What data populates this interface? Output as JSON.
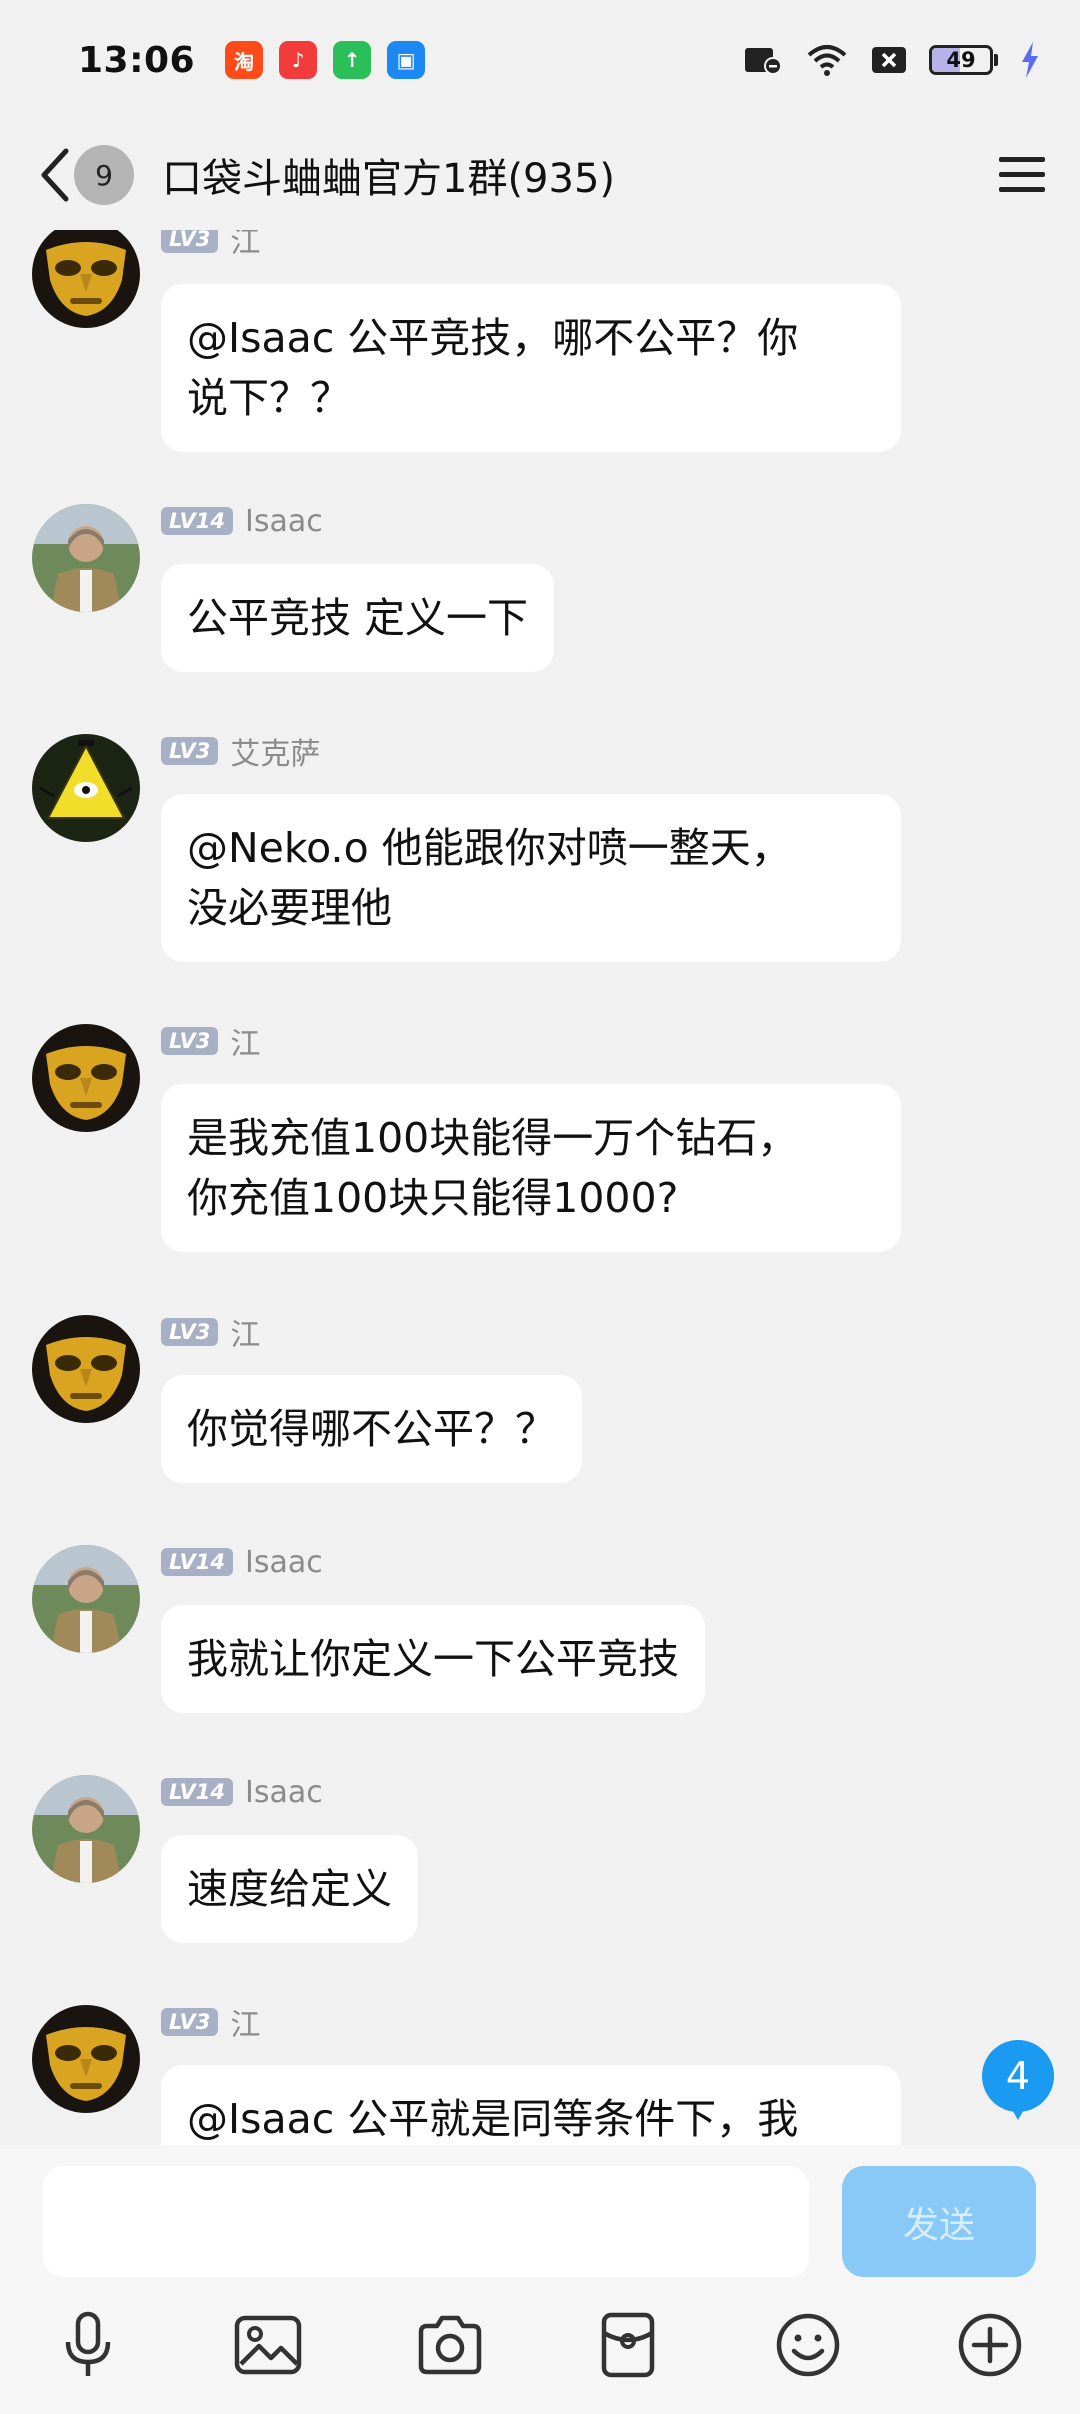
{
  "status_bar": {
    "time": "13:06",
    "apps": [
      {
        "icon": "taobao-icon",
        "glyph": "淘",
        "color": "#ff4a1a"
      },
      {
        "icon": "music-icon",
        "glyph": "♪",
        "color": "#f23b3b"
      },
      {
        "icon": "upload-icon",
        "glyph": "↑",
        "color": "#2bbf5a"
      },
      {
        "icon": "wallet-icon",
        "glyph": "▣",
        "color": "#1e88f2"
      }
    ],
    "battery_level": "49"
  },
  "header": {
    "unread_count": "9",
    "title": "口袋斗蛐蛐官方1群(935)"
  },
  "messages": [
    {
      "sender": "江",
      "level": "LV3",
      "avatar": "mask",
      "text_lines": [
        "@Isaac 公平竞技，哪不公平？你",
        "说下？？"
      ]
    },
    {
      "sender": "Isaac",
      "level": "LV14",
      "avatar": "man",
      "text_lines": [
        "公平竞技 定义一下"
      ]
    },
    {
      "sender": "艾克萨",
      "level": "LV3",
      "avatar": "triangle",
      "text_lines": [
        "@Neko.o 他能跟你对喷一整天，",
        "没必要理他"
      ]
    },
    {
      "sender": "江",
      "level": "LV3",
      "avatar": "mask",
      "text_lines": [
        "是我充值100块能得一万个钻石，",
        "你充值100块只能得1000?"
      ]
    },
    {
      "sender": "江",
      "level": "LV3",
      "avatar": "mask",
      "text_lines": [
        "你觉得哪不公平？？"
      ]
    },
    {
      "sender": "Isaac",
      "level": "LV14",
      "avatar": "man",
      "text_lines": [
        "我就让你定义一下公平竞技"
      ]
    },
    {
      "sender": "Isaac",
      "level": "LV14",
      "avatar": "man",
      "text_lines": [
        "速度给定义"
      ]
    },
    {
      "sender": "江",
      "level": "LV3",
      "avatar": "mask",
      "text_lines": [
        "@Isaac 公平就是同等条件下，我"
      ]
    }
  ],
  "new_message_count": "4",
  "input": {
    "placeholder": "",
    "send_label": "发送"
  },
  "toolbar": [
    "microphone-icon",
    "image-icon",
    "camera-icon",
    "red-packet-icon",
    "emoji-icon",
    "plus-icon"
  ]
}
